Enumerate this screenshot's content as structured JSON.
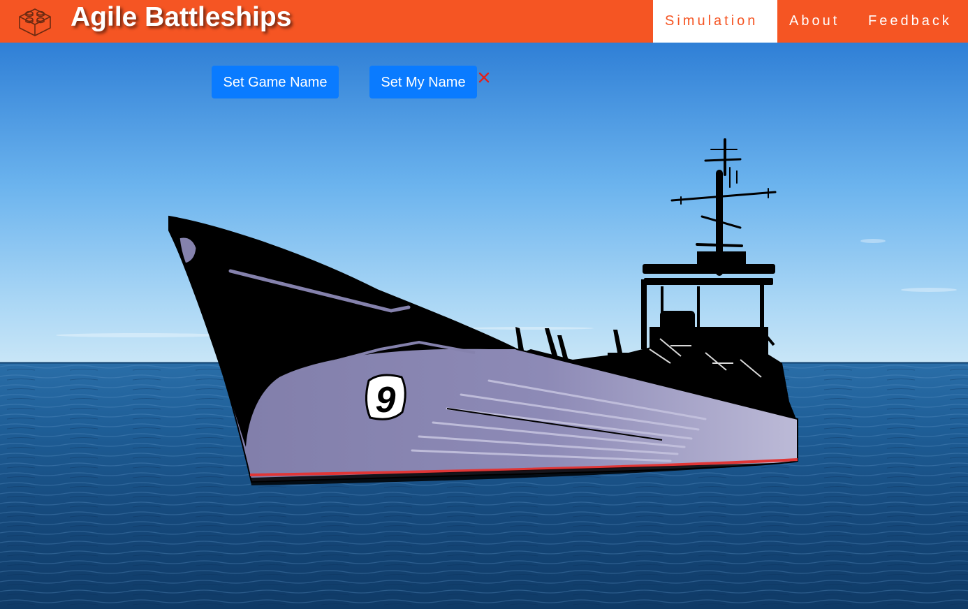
{
  "header": {
    "title": "Agile Battleships",
    "logo_icon": "lego-brick-icon",
    "tabs": [
      {
        "label": "Simulation",
        "active": true
      },
      {
        "label": "About",
        "active": false
      },
      {
        "label": "Feedback",
        "active": false
      }
    ]
  },
  "main": {
    "set_game_name_label": "Set Game Name",
    "set_my_name_label": "Set My Name",
    "clear_icon": "close-icon",
    "ship_number": "9"
  },
  "colors": {
    "header": "#f55523",
    "button": "#0a7bff",
    "close": "#e0211d",
    "hull": "#8582ad"
  }
}
